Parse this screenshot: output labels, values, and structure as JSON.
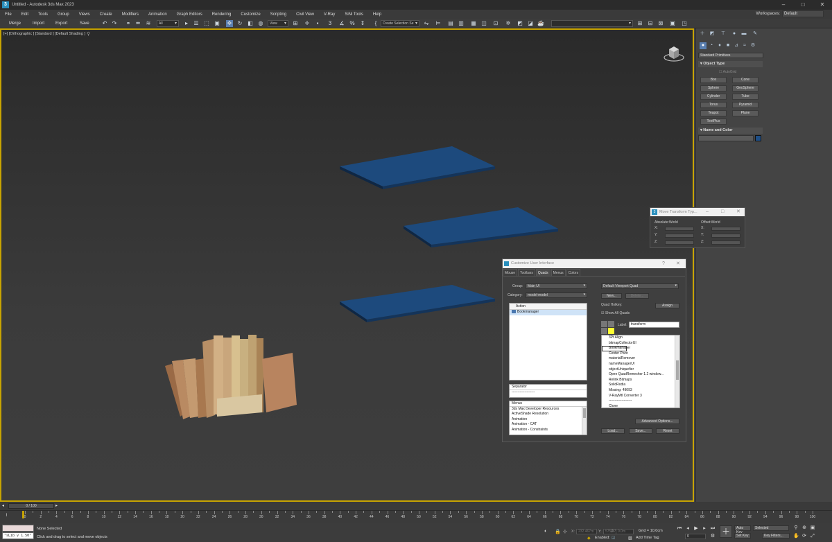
{
  "window": {
    "title": "Untitled - Autodesk 3ds Max 2023",
    "app_icon": "3"
  },
  "menu": [
    "File",
    "Edit",
    "Tools",
    "Group",
    "Views",
    "Create",
    "Modifiers",
    "Animation",
    "Graph Editors",
    "Rendering",
    "Customize",
    "Scripting",
    "Civil View",
    "V-Ray",
    "SiNi Tools",
    "Help"
  ],
  "workspace": {
    "label": "Workspaces:",
    "value": "Default"
  },
  "toolbar": {
    "merge": "Merge",
    "import": "Import",
    "export": "Export",
    "save": "Save",
    "filter_value": "All",
    "ref_coord_value": "View",
    "selection_set_value": "Create Selection Se"
  },
  "viewport": {
    "label": "[+] [Orthographic ] [Standard ] [Default Shading ]"
  },
  "command_panel": {
    "category_value": "Standard Primitives",
    "object_type_title": "Object Type",
    "autogrid": "AutoGrid",
    "primitives": [
      "Box",
      "Cone",
      "Sphere",
      "GeoSphere",
      "Cylinder",
      "Tube",
      "Torus",
      "Pyramid",
      "Teapot",
      "Plane",
      "TextPlus"
    ],
    "name_color_title": "Name and Color",
    "swatch_color": "#1f4f86"
  },
  "move_dialog": {
    "title": "Move Transform Typ...",
    "absolute_label": "Absolute:World",
    "offset_label": "Offset:World",
    "axes": [
      "X:",
      "Y:",
      "Z:"
    ]
  },
  "customize_ui": {
    "title": "Customize User Interface",
    "tabs": [
      "Mouse",
      "Toolbars",
      "Quads",
      "Menus",
      "Colors"
    ],
    "active_tab": "Quads",
    "group_label": "Group:",
    "group_value": "Main UI",
    "category_label": "Category:",
    "category_value": "model-model",
    "action_header": "Action",
    "actions": [
      "Bookmanager"
    ],
    "separator_header": "Separator",
    "separator_item": "--------------------",
    "menus_header": "Menus",
    "menus": [
      "3ds Max Developer Resources",
      "ActiveShade Resolution",
      "Animation",
      "Animation - CAT",
      "Animation - Constraints"
    ],
    "quad_menu_value": "Default Viewport Quad",
    "new_btn": "New...",
    "delete_btn": "Delete...",
    "hotkey_label": "Quad Hotkey:",
    "assign_btn": "Assign",
    "show_all_label": "Show All Quads",
    "label_text": "Label:",
    "label_value": "transform",
    "quad_items": [
      "3Pt Align",
      "bitmapCollectorUI",
      "Bookmanager",
      "Center Pivot",
      "materialRemover",
      "nameManagerUI",
      "objectUniquefier",
      "Open QuadRemesher 1.2 window...",
      "Relink Bitmaps",
      "SolidRodia",
      "Missing: 49093",
      "V-RayMtl Converter 3",
      "--------------------",
      "Clone"
    ],
    "quad_selected": "Bookmanager",
    "advanced_btn": "Advanced Options...",
    "load_btn": "Load...",
    "save_btn": "Save...",
    "reset_btn": "Reset"
  },
  "timeline": {
    "frame_display": "0 / 100",
    "ticks": [
      "0",
      "2",
      "4",
      "6",
      "8",
      "10",
      "12",
      "14",
      "16",
      "18",
      "20",
      "22",
      "24",
      "26",
      "28",
      "30",
      "32",
      "34",
      "36",
      "38",
      "40",
      "42",
      "44",
      "46",
      "48",
      "50",
      "52",
      "54",
      "56",
      "58",
      "60",
      "62",
      "64",
      "66",
      "68",
      "70",
      "72",
      "74",
      "76",
      "78",
      "80",
      "82",
      "84",
      "86",
      "88",
      "90",
      "92",
      "94",
      "96",
      "98",
      "100"
    ]
  },
  "status": {
    "maxscript_output": "\"sLib v 1.50\"",
    "selection": "None Selected",
    "prompt": "Click and drag to select and move objects",
    "x_label": "X:",
    "x_value": "232.467m",
    "y_label": "Y:",
    "y_value": "575.475m",
    "z_label": "Z:",
    "z_value": "0.0m",
    "grid": "Grid = 10.0cm",
    "enabled": "Enabled:",
    "add_time_tag": "Add Time Tag",
    "auto_key": "Auto Key",
    "set_key": "Set Key",
    "key_mode_value": "Selected",
    "key_filters": "Key Filters...",
    "frame_value": "0"
  },
  "colors": {
    "accent": "#c8a400",
    "platform": "#1d4a7d",
    "dialog_title_bg": "#f2f2f2"
  }
}
